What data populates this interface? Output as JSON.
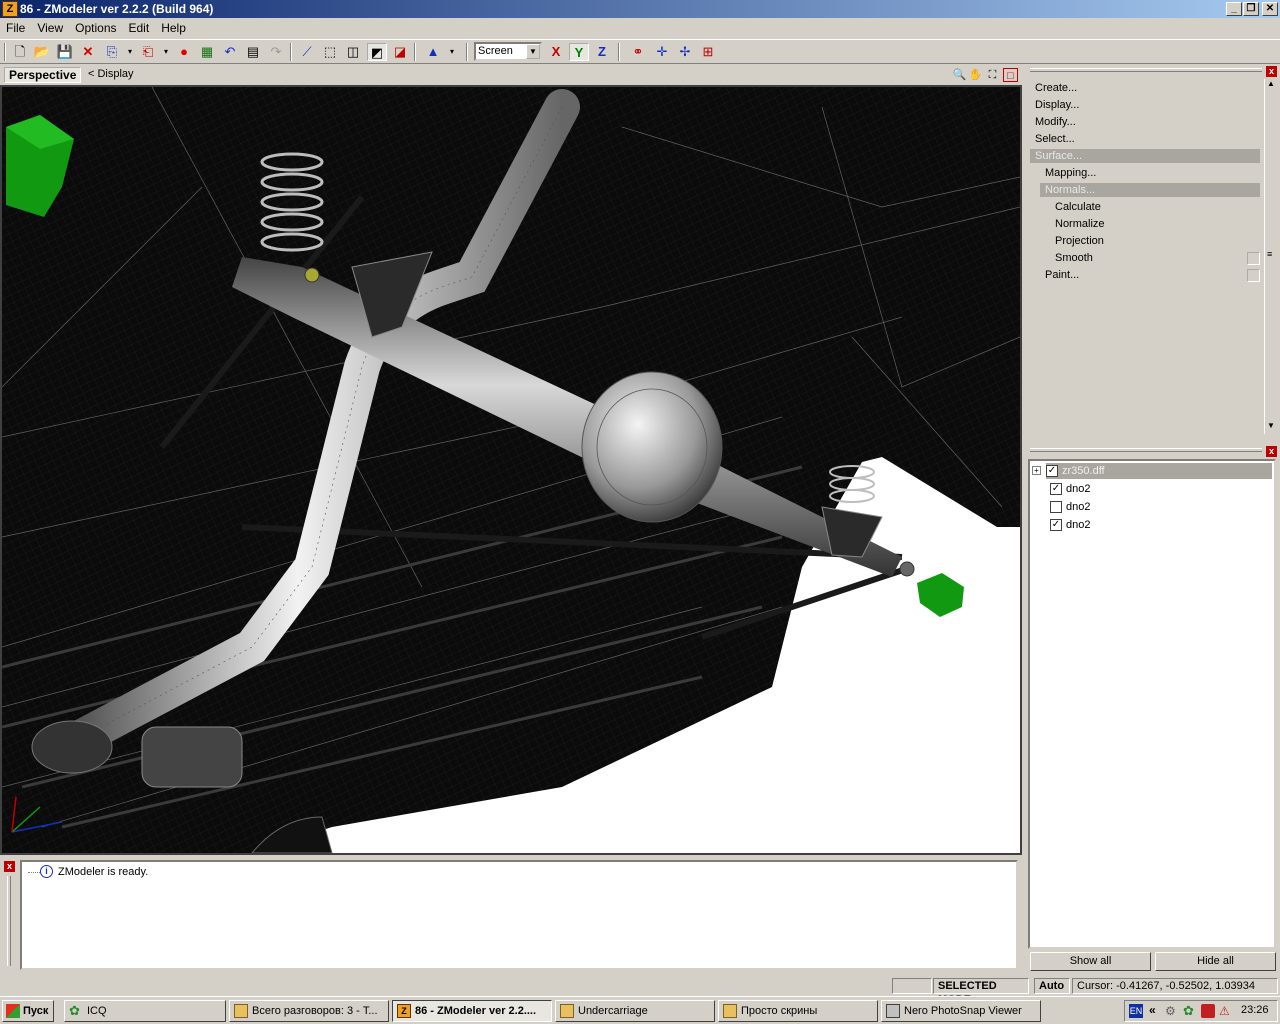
{
  "window": {
    "title": "86 - ZModeler ver 2.2.2 (Build 964)",
    "app_icon_letter": "Z",
    "min_glyph": "_",
    "max_glyph": "❐",
    "close_glyph": "✕"
  },
  "menu": {
    "file": "File",
    "view": "View",
    "options": "Options",
    "edit": "Edit",
    "help": "Help"
  },
  "toolbar": {
    "select_value": "Screen",
    "axis_x": "X",
    "axis_y": "Y",
    "axis_z": "Z"
  },
  "viewport": {
    "name": "Perspective",
    "breadcrumb": "<  Display"
  },
  "command_panel": {
    "items": [
      "Create...",
      "Display...",
      "Modify...",
      "Select...",
      "Surface...",
      "Mapping...",
      "Normals...",
      "Calculate",
      "Normalize",
      "Projection",
      "Smooth",
      "Paint..."
    ]
  },
  "scene": {
    "root": "zr350.dff",
    "nodes": [
      {
        "label": "dno2",
        "checked": true
      },
      {
        "label": "dno2",
        "checked": false
      },
      {
        "label": "dno2",
        "checked": true
      }
    ],
    "show_all": "Show all",
    "hide_all": "Hide all"
  },
  "log": {
    "message": "ZModeler is ready."
  },
  "status": {
    "mode": "SELECTED MODE",
    "auto": "Auto",
    "cursor": "Cursor: -0.41267, -0.52502, 1.03934"
  },
  "taskbar": {
    "start": "Пуск",
    "tasks": [
      "ICQ",
      "Всего разговоров: 3 - Т...",
      "86 - ZModeler ver 2.2....",
      "Undercarriage",
      "Просто скрины",
      "Nero PhotoSnap Viewer"
    ],
    "lang": "EN",
    "chevron": "«",
    "clock": "23:26"
  },
  "colors": {
    "title_start": "#0a246a",
    "title_end": "#a6caf0",
    "dummy_green": "#119911"
  }
}
